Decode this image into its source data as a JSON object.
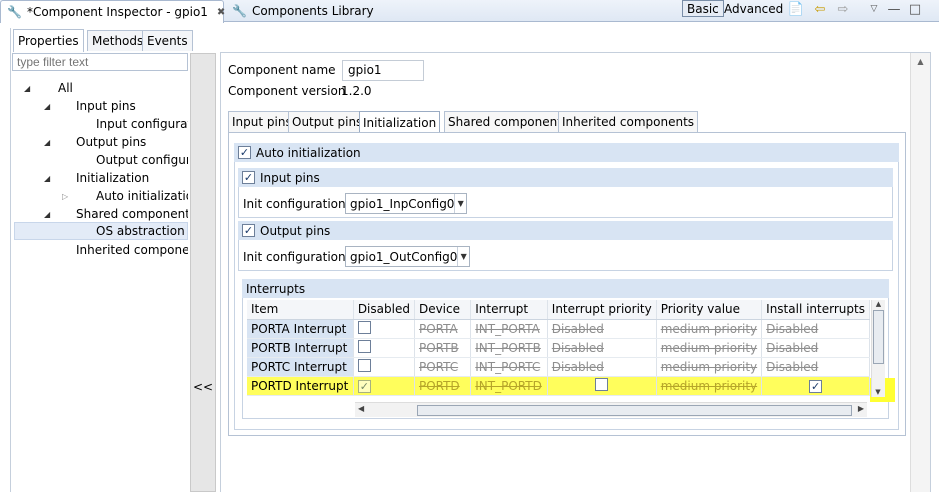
{
  "tabs": {
    "inspector": "*Component Inspector - gpio1",
    "library": "Components Library"
  },
  "toolbar": {
    "basic": "Basic",
    "advanced": "Advanced"
  },
  "left": {
    "tabs": [
      "Properties",
      "Methods",
      "Events"
    ],
    "filter_placeholder": "type filter text",
    "tree": [
      {
        "label": "All",
        "level": 0,
        "twisty": "expanded"
      },
      {
        "label": "Input pins",
        "level": 1,
        "twisty": "expanded"
      },
      {
        "label": "Input configurati",
        "level": 2,
        "twisty": "none"
      },
      {
        "label": "Output pins",
        "level": 1,
        "twisty": "expanded"
      },
      {
        "label": "Output configura",
        "level": 2,
        "twisty": "none"
      },
      {
        "label": "Initialization",
        "level": 1,
        "twisty": "expanded"
      },
      {
        "label": "Auto initializatior",
        "level": 2,
        "twisty": "collapsed"
      },
      {
        "label": "Shared components",
        "level": 1,
        "twisty": "expanded"
      },
      {
        "label": "OS abstraction la",
        "level": 2,
        "twisty": "none",
        "selected": true
      },
      {
        "label": "Inherited componen",
        "level": 1,
        "twisty": "none"
      }
    ]
  },
  "splitter": {
    "label": "<<"
  },
  "right": {
    "component_name_label": "Component name",
    "component_name_value": "gpio1",
    "component_version_label": "Component version",
    "component_version_value": "1.2.0",
    "tabs": [
      "Input pins",
      "Output pins",
      "Initialization",
      "Shared components",
      "Inherited components"
    ],
    "auto_init_label": "Auto initialization",
    "input_pins_label": "Input pins",
    "init_config_label": "Init configuration",
    "input_config_value": "gpio1_InpConfig0",
    "output_pins_label": "Output pins",
    "output_config_value": "gpio1_OutConfig0",
    "interrupts_label": "Interrupts",
    "columns": [
      "Item",
      "Disabled",
      "Device",
      "Interrupt",
      "Interrupt priority",
      "Priority value",
      "Install interrupts"
    ],
    "rows": [
      {
        "item": "PORTA Interrupt",
        "device": "PORTA",
        "interrupt": "INT_PORTA",
        "priority": "Disabled",
        "prio_value": "medium priority",
        "install": "Disabled"
      },
      {
        "item": "PORTB Interrupt",
        "device": "PORTB",
        "interrupt": "INT_PORTB",
        "priority": "Disabled",
        "prio_value": "medium priority",
        "install": "Disabled"
      },
      {
        "item": "PORTC Interrupt",
        "device": "PORTC",
        "interrupt": "INT_PORTC",
        "priority": "Disabled",
        "prio_value": "medium priority",
        "install": "Disabled"
      },
      {
        "item": "PORTD Interrupt",
        "device": "PORTD",
        "interrupt": "INT_PORTD",
        "priority": "",
        "prio_value": "medium priority",
        "install": ""
      }
    ]
  },
  "colors": {
    "highlight": "#ffff33",
    "section": "#d8e4f3"
  }
}
